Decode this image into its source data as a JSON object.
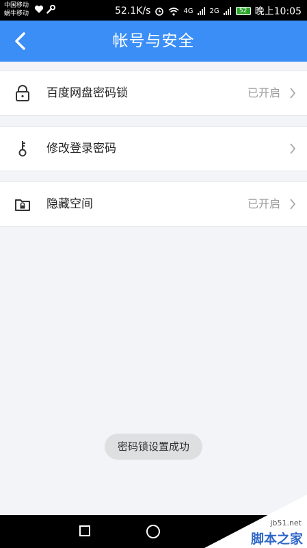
{
  "status_bar": {
    "carrier_1": "中国移动",
    "carrier_2": "蜗牛移动",
    "speed": "52.1K/s",
    "net_4g": "4G",
    "net_2g": "2G",
    "battery": "52",
    "time": "晚上10:05"
  },
  "header": {
    "title": "帐号与安全"
  },
  "items": [
    {
      "label": "百度网盘密码锁",
      "status": "已开启",
      "icon": "lock-icon"
    },
    {
      "label": "修改登录密码",
      "status": "",
      "icon": "key-icon"
    },
    {
      "label": "隐藏空间",
      "status": "已开启",
      "icon": "folder-lock-icon"
    }
  ],
  "toast": {
    "text": "密码锁设置成功"
  },
  "watermark": {
    "url": "jb51.net",
    "brand": "脚本之家"
  },
  "colors": {
    "accent": "#3a8ef6",
    "background": "#f2f4f7"
  }
}
